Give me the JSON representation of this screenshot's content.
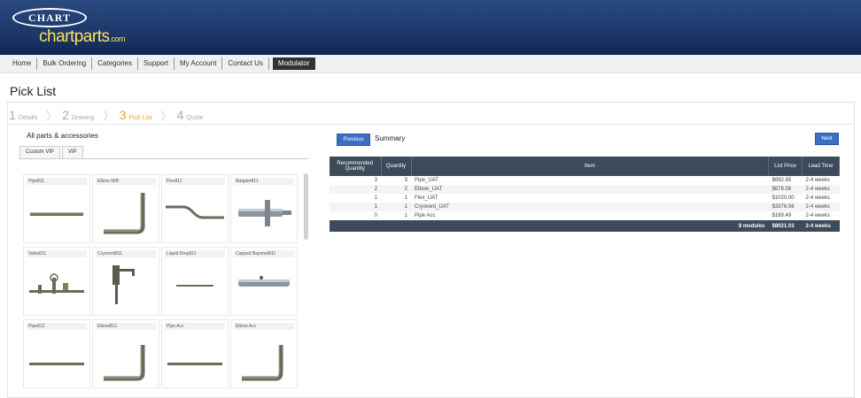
{
  "header": {
    "brand_logo": "CHART",
    "site_logo": "chartparts",
    "site_logo_suffix": ".com"
  },
  "nav": {
    "items": [
      "Home",
      "Bulk Ordering",
      "Categories",
      "Support",
      "My Account",
      "Contact Us",
      "Modulator"
    ]
  },
  "page_title": "Pick List",
  "steps": [
    {
      "num": "1",
      "label": "Details"
    },
    {
      "num": "2",
      "label": "Drawing"
    },
    {
      "num": "3",
      "label": "Pick List"
    },
    {
      "num": "4",
      "label": "Quote"
    }
  ],
  "left_panel": {
    "title": "All parts & accessories",
    "tabs": [
      "Custom VIP",
      "VIP"
    ],
    "parts": [
      {
        "name": "Pipe811",
        "icon": "pipe-straight-icon"
      },
      {
        "name": "Elbow 90B",
        "icon": "pipe-elbow-icon"
      },
      {
        "name": "Flex811",
        "icon": "flex-hose-icon"
      },
      {
        "name": "Adapter811",
        "icon": "adapter-icon"
      },
      {
        "name": "Valve811",
        "icon": "valve-icon"
      },
      {
        "name": "Cryovent811",
        "icon": "cryovent-icon"
      },
      {
        "name": "Liquid Drop811",
        "icon": "liquid-drop-icon"
      },
      {
        "name": "Capped Bayonet811",
        "icon": "capped-bayonet-icon"
      },
      {
        "name": "Pipe812",
        "icon": "pipe-straight-icon"
      },
      {
        "name": "Elbow812",
        "icon": "pipe-elbow-icon"
      },
      {
        "name": "Pipe Acc",
        "icon": "pipe-straight-icon"
      },
      {
        "name": "Elbow Acc",
        "icon": "pipe-elbow-icon"
      }
    ]
  },
  "right_panel": {
    "previous_label": "Previous",
    "summary_label": "Summary",
    "next_label": "Next",
    "columns": [
      "Recommended Quantity",
      "Quantity",
      "Item",
      "List Price",
      "Lead Time"
    ],
    "rows": [
      {
        "rec": "3",
        "qty": "3",
        "item": "Pipe_UAT",
        "price": "$692.95",
        "lead": "2-4 weeks"
      },
      {
        "rec": "2",
        "qty": "2",
        "item": "Elbow_UAT",
        "price": "$678.06",
        "lead": "2-4 weeks"
      },
      {
        "rec": "1",
        "qty": "1",
        "item": "Flex_UAT",
        "price": "$1020.00",
        "lead": "2-4 weeks"
      },
      {
        "rec": "1",
        "qty": "1",
        "item": "Cryovent_UAT",
        "price": "$3376.56",
        "lead": "2-4 weeks"
      },
      {
        "rec": "0",
        "qty": "1",
        "item": "Pipe Acc",
        "price": "$189.49",
        "lead": "2-4 weeks"
      }
    ],
    "total": {
      "modules": "8 modules",
      "price": "$8021.03",
      "lead": "2-4 weeks"
    }
  }
}
